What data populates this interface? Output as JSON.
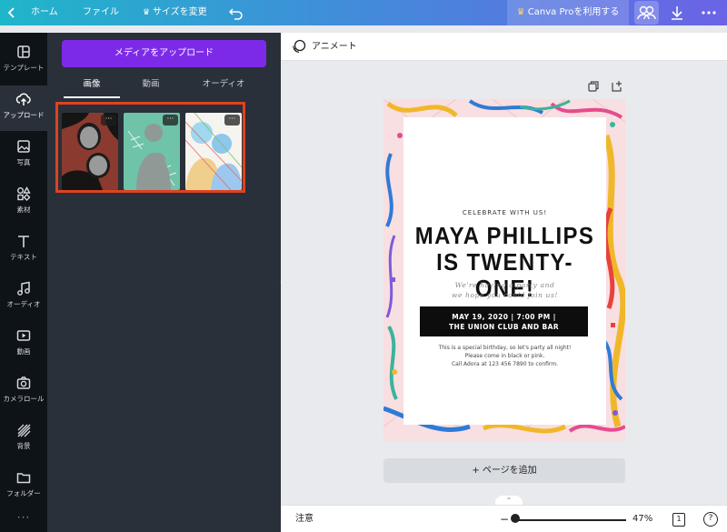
{
  "topbar": {
    "home": "ホーム",
    "file": "ファイル",
    "resize": "サイズを変更",
    "pro": "Canva Proを利用する"
  },
  "rail": [
    {
      "label": "テンプレート",
      "icon": "template-icon"
    },
    {
      "label": "アップロード",
      "icon": "upload-icon"
    },
    {
      "label": "写真",
      "icon": "photo-icon"
    },
    {
      "label": "素材",
      "icon": "elements-icon"
    },
    {
      "label": "テキスト",
      "icon": "text-icon"
    },
    {
      "label": "オーディオ",
      "icon": "audio-icon"
    },
    {
      "label": "動画",
      "icon": "video-icon"
    },
    {
      "label": "カメラロール",
      "icon": "camera-icon"
    },
    {
      "label": "背景",
      "icon": "background-icon"
    },
    {
      "label": "フォルダー",
      "icon": "folder-icon"
    }
  ],
  "panel": {
    "upload_button": "メディアをアップロード",
    "tabs": [
      "画像",
      "動画",
      "オーディオ"
    ],
    "thumb_more": "···"
  },
  "canvas": {
    "animate": "アニメート"
  },
  "design": {
    "kicker": "CELEBRATE WITH US!",
    "title_line1": "MAYA PHILLIPS",
    "title_line2": "IS TWENTY-ONE!",
    "sub_line1": "We're having a party and",
    "sub_line2": "we hope you could join us!",
    "bar_line1": "MAY 19, 2020 | 7:00 PM |",
    "bar_line2": "THE UNION CLUB AND BAR",
    "body_line1": "This is a special birthday, so let's party all night!",
    "body_line2": "Please come in black or pink.",
    "body_line3": "Call Adora at 123 456 7890 to confirm."
  },
  "add_page": "+ ページを追加",
  "bottombar": {
    "notes": "注意",
    "zoom": "47%",
    "pages": "1",
    "help": "?"
  },
  "colors": {
    "accent": "#7d2ae8",
    "highlight": "#e0421f",
    "rail_bg": "#0e1318",
    "panel_bg": "#293039"
  }
}
